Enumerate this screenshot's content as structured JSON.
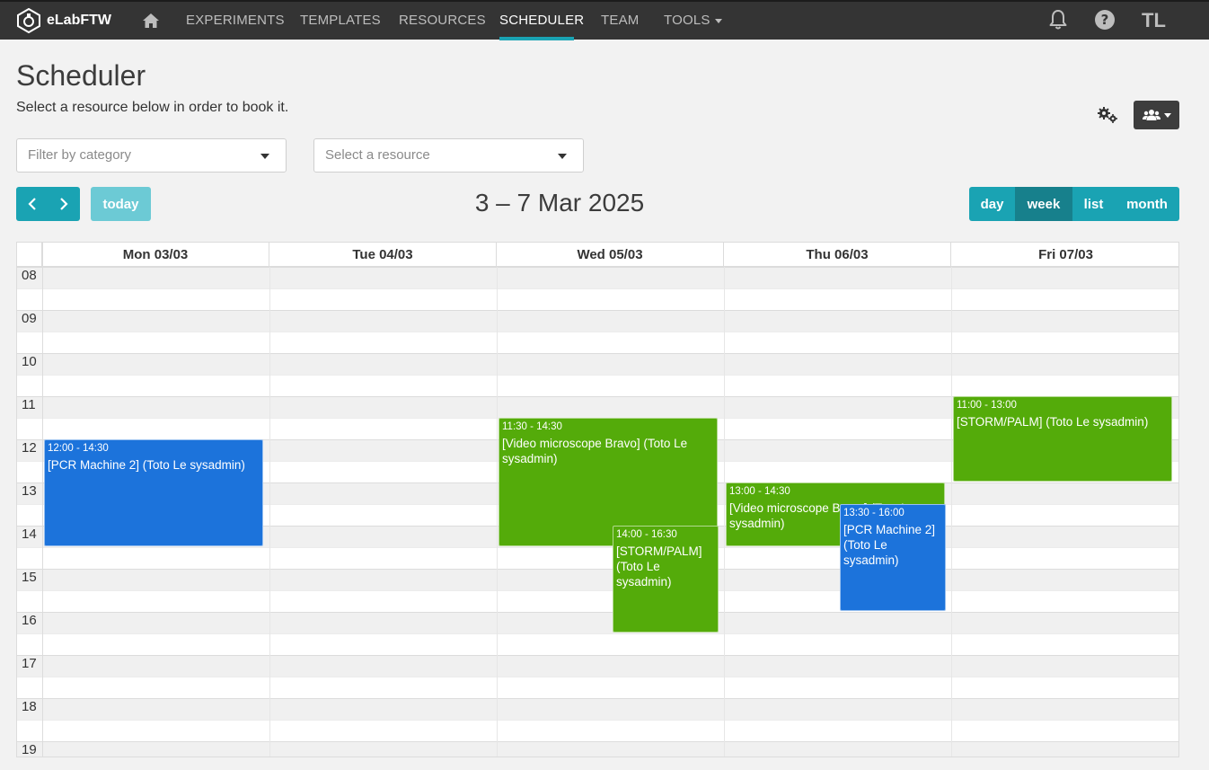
{
  "navbar": {
    "brand": "eLabFTW",
    "links": [
      "EXPERIMENTS",
      "TEMPLATES",
      "RESOURCES",
      "SCHEDULER",
      "TEAM",
      "TOOLS"
    ],
    "active": "SCHEDULER",
    "user_initials": "TL",
    "accent_color": "#1aa3b3"
  },
  "page": {
    "title": "Scheduler",
    "subtitle": "Select a resource below in order to book it."
  },
  "filters": {
    "category_placeholder": "Filter by category",
    "resource_placeholder": "Select a resource"
  },
  "toolbar": {
    "today_label": "today",
    "range_title": "3 – 7 Mar 2025",
    "views": [
      "day",
      "week",
      "list",
      "month"
    ],
    "active_view": "week"
  },
  "calendar": {
    "days": [
      "Mon 03/03",
      "Tue 04/03",
      "Wed 05/03",
      "Thu 06/03",
      "Fri 07/03"
    ],
    "hours": [
      "08",
      "09",
      "10",
      "11",
      "12",
      "13",
      "14",
      "15",
      "16",
      "17",
      "18",
      "19"
    ],
    "events": [
      {
        "day": 0,
        "start": "12:00",
        "end": "14:30",
        "time": "12:00 - 14:30",
        "title": "[PCR Machine 2] (Toto Le sysadmin)",
        "color": "blue"
      },
      {
        "day": 2,
        "start": "11:30",
        "end": "14:30",
        "time": "11:30 - 14:30",
        "title": "[Video microscope Bravo] (Toto Le sysadmin)",
        "color": "green"
      },
      {
        "day": 2,
        "start": "14:00",
        "end": "16:30",
        "time": "14:00 - 16:30",
        "title": "[STORM/PALM] (Toto Le sysadmin)",
        "color": "green"
      },
      {
        "day": 3,
        "start": "13:00",
        "end": "14:30",
        "time": "13:00 - 14:30",
        "title": "[Video microscope Bravo] (Toto Le sysadmin)",
        "color": "green"
      },
      {
        "day": 3,
        "start": "13:30",
        "end": "16:00",
        "time": "13:30 - 16:00",
        "title": "[PCR Machine 2] (Toto Le sysadmin)",
        "color": "blue"
      },
      {
        "day": 4,
        "start": "11:00",
        "end": "13:00",
        "time": "11:00 - 13:00",
        "title": "[STORM/PALM] (Toto Le sysadmin)",
        "color": "green"
      }
    ],
    "colors": {
      "green": "#54ab0a",
      "blue": "#1c73db"
    }
  }
}
